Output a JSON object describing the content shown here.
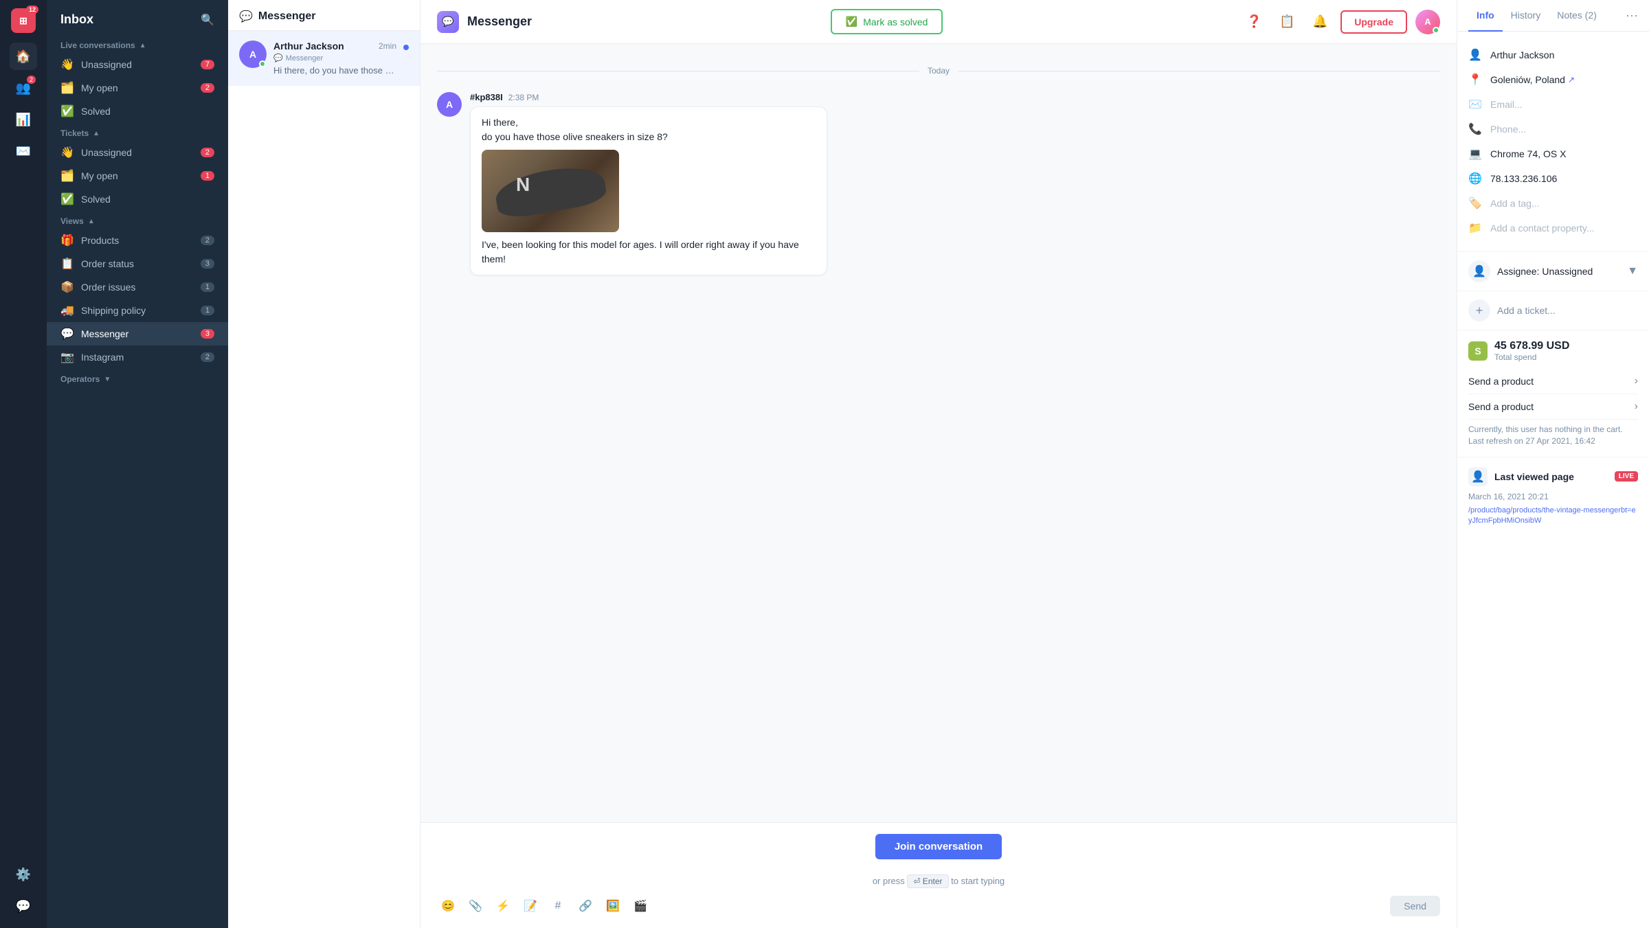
{
  "app": {
    "nav_badge": "12",
    "title": "Inbox"
  },
  "header": {
    "channel_name": "Messenger",
    "mark_solved_label": "Mark as solved",
    "upgrade_label": "Upgrade"
  },
  "sidebar": {
    "title": "Inbox",
    "live_conversations_label": "Live conversations",
    "live_conversations_expanded": true,
    "live_items": [
      {
        "icon": "👋",
        "label": "Unassigned",
        "count": "7",
        "count_type": "red"
      },
      {
        "icon": "🗂️",
        "label": "My open",
        "count": "2",
        "count_type": "red"
      },
      {
        "icon": "✅",
        "label": "Solved",
        "count": "",
        "count_type": ""
      }
    ],
    "tickets_label": "Tickets",
    "tickets_expanded": true,
    "ticket_items": [
      {
        "icon": "👋",
        "label": "Unassigned",
        "count": "2",
        "count_type": "red"
      },
      {
        "icon": "🗂️",
        "label": "My open",
        "count": "1",
        "count_type": "red"
      },
      {
        "icon": "✅",
        "label": "Solved",
        "count": "",
        "count_type": ""
      }
    ],
    "views_label": "Views",
    "views_expanded": true,
    "view_items": [
      {
        "icon": "🎁",
        "label": "Products",
        "count": "2",
        "count_type": "blue"
      },
      {
        "icon": "📋",
        "label": "Order status",
        "count": "3",
        "count_type": "blue"
      },
      {
        "icon": "📦",
        "label": "Order issues",
        "count": "1",
        "count_type": "blue"
      },
      {
        "icon": "🚚",
        "label": "Shipping policy",
        "count": "1",
        "count_type": "blue"
      },
      {
        "icon": "💬",
        "label": "Messenger",
        "count": "3",
        "count_type": "red",
        "active": true
      },
      {
        "icon": "📷",
        "label": "Instagram",
        "count": "2",
        "count_type": "blue"
      }
    ],
    "operators_label": "Operators"
  },
  "conv_list": {
    "title": "Messenger",
    "items": [
      {
        "name": "Arthur Jackson",
        "channel": "Messenger",
        "time": "2min",
        "preview": "Hi there, do you have those olive...",
        "avatar_letter": "A",
        "avatar_color": "#7c6af7",
        "has_unread": true,
        "active": true
      }
    ]
  },
  "chat": {
    "date_label": "Today",
    "messages": [
      {
        "sender": "#kp838I",
        "time": "2:38 PM",
        "avatar_letter": "A",
        "avatar_color": "#7c6af7",
        "lines": [
          "Hi there,",
          "do you have those olive sneakers in size 8?",
          "I've, been looking for this model for ages. I will order right away if you have them!"
        ],
        "has_image": true
      }
    ],
    "join_btn_label": "Join conversation",
    "press_hint_prefix": "or press",
    "press_enter_label": "⏎ Enter",
    "press_hint_suffix": "to start typing",
    "toolbar_tools": [
      "😊",
      "📎",
      "⚡",
      "📝",
      "#",
      "🔗",
      "🖼️",
      "🎬"
    ]
  },
  "right_panel": {
    "tabs": [
      {
        "label": "Info",
        "active": true
      },
      {
        "label": "History",
        "active": false
      },
      {
        "label": "Notes (2)",
        "active": false
      }
    ],
    "info": {
      "name": "Arthur Jackson",
      "location": "Goleniów, Poland",
      "email_placeholder": "Email...",
      "phone_placeholder": "Phone...",
      "browser": "Chrome 74, OS X",
      "ip": "78.133.236.106",
      "tag_placeholder": "Add a tag...",
      "contact_property_placeholder": "Add a contact property..."
    },
    "assignee": {
      "label": "Assignee: Unassigned"
    },
    "ticket": {
      "label": "Add a ticket..."
    },
    "shopify": {
      "amount": "45 678.99 USD",
      "amount_label": "Total spend",
      "rows": [
        {
          "label": "Send a product"
        },
        {
          "label": "Send a product"
        }
      ],
      "cart_empty": "Currently, this user has nothing in the cart.",
      "last_refresh": "Last refresh on 27 Apr 2021, 16:42"
    },
    "last_viewed": {
      "title": "Last viewed page",
      "date": "March 16, 2021 20:21",
      "is_live": true,
      "live_label": "LIVE",
      "url": "/product/bag/products/the-vintage-messengerbt=eyJfcmFpbHMiOnsibW"
    }
  }
}
